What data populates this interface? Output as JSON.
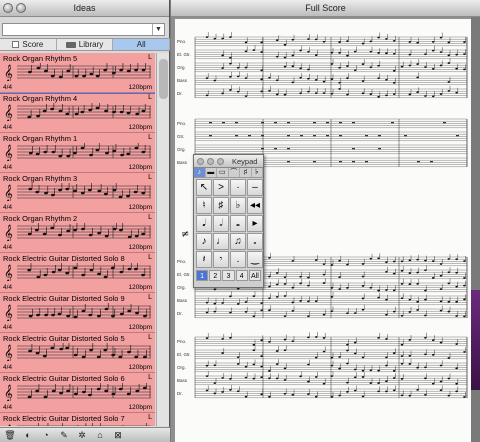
{
  "ideas_window": {
    "title": "Ideas",
    "search_arrow": "▼",
    "filters": [
      {
        "label": "Score",
        "active": false
      },
      {
        "label": "Library",
        "active": false
      },
      {
        "label": "All",
        "active": true
      }
    ],
    "items": [
      {
        "name": "Rock Organ Rhythm 5",
        "loop": "L",
        "time_sig": "4/4",
        "tempo": "120bpm"
      },
      {
        "name": "Rock Organ Rhythm 4",
        "loop": "L",
        "time_sig": "4/4",
        "tempo": "120bpm"
      },
      {
        "name": "Rock Organ Rhythm 1",
        "loop": "L",
        "time_sig": "4/4",
        "tempo": "120bpm"
      },
      {
        "name": "Rock Organ Rhythm 3",
        "loop": "L",
        "time_sig": "4/4",
        "tempo": "120bpm"
      },
      {
        "name": "Rock Organ Rhythm 2",
        "loop": "L",
        "time_sig": "4/4",
        "tempo": "120bpm"
      },
      {
        "name": "Rock Electric Guitar Distorted Solo 8",
        "loop": "L",
        "time_sig": "4/4",
        "tempo": "120bpm"
      },
      {
        "name": "Rock Electric Guitar Distorted Solo 9",
        "loop": "L",
        "time_sig": "4/4",
        "tempo": "120bpm"
      },
      {
        "name": "Rock Electric Guitar Distorted Solo 5",
        "loop": "L",
        "time_sig": "4/4",
        "tempo": "120bpm"
      },
      {
        "name": "Rock Electric Guitar Distorted Solo 6",
        "loop": "L",
        "time_sig": "4/4",
        "tempo": "120bpm"
      },
      {
        "name": "Rock Electric Guitar Distorted Solo 7",
        "loop": "L",
        "time_sig": "",
        "tempo": ""
      }
    ],
    "toolbar_icons": [
      "trash-icon",
      "capture-icon",
      "lightbulb-icon",
      "edit-icon",
      "settings-icon",
      "tag-icon",
      "import-icon"
    ]
  },
  "score_window": {
    "title": "Full Score",
    "staff_labels_top": [
      "Pno.",
      "El. Gtr.",
      "Org.",
      "Bass",
      "Dr."
    ],
    "staff_labels_mid": [
      "Pno.",
      "Gtr.",
      "Org.",
      "Bass"
    ]
  },
  "keypad": {
    "title": "Keypad",
    "layouts": [
      "♪",
      "▬",
      "▭",
      "⌒",
      "♯",
      "𝄬"
    ],
    "keys": [
      "↖",
      ">",
      "·",
      "–",
      "♮",
      "♯",
      "♭",
      "◂◂",
      "𝅘𝅥",
      "𝅗𝅥",
      "𝅝",
      "▸",
      "♪",
      "♩",
      "♫",
      "𝅗",
      "𝄽",
      "𝄾",
      ".",
      "‿"
    ],
    "tabs": [
      "1",
      "2",
      "3",
      "4",
      "All"
    ],
    "active_tab": "1"
  }
}
